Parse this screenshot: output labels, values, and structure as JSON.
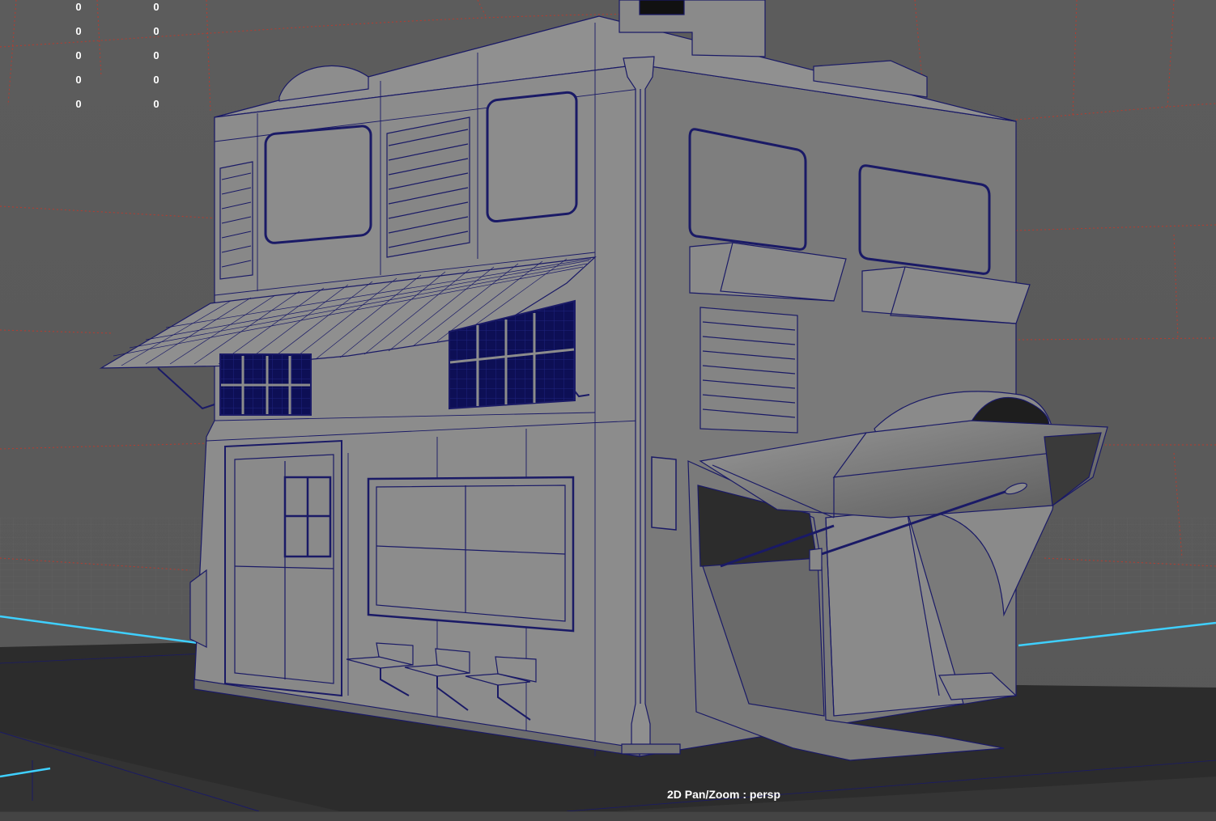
{
  "viewport": {
    "camera": "persp",
    "mode_label": "2D Pan/Zoom : persp"
  },
  "hud": {
    "left_column": [
      "0",
      "0",
      "0",
      "0",
      "0"
    ],
    "right_column": [
      "0",
      "0",
      "0",
      "0",
      "0"
    ]
  },
  "colors": {
    "background": "#5b5b5b",
    "ground": "#2b2b2b",
    "wire": "#1a1a66",
    "surface": "#8a8a8a",
    "glass": "#0d0f55",
    "grid_red": "#c0392b",
    "axis_cyan": "#3fd0ff",
    "hud_text": "#ffffff"
  }
}
